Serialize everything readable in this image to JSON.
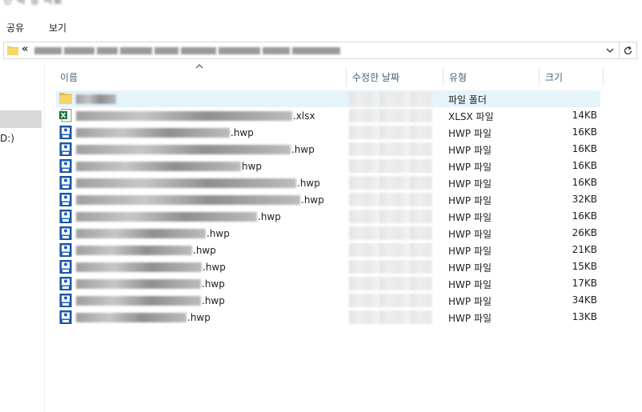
{
  "window": {
    "title": "연 락 망 자료"
  },
  "ribbon": {
    "tabs": [
      "공유",
      "보기"
    ]
  },
  "address": {
    "prefix": "«"
  },
  "nav": {
    "drive_label": "D:)"
  },
  "columns": {
    "name": "이름",
    "date": "수정한 날짜",
    "type": "유형",
    "size": "크기"
  },
  "files": [
    {
      "ext": "",
      "type": "파일 폴더",
      "size": "",
      "icon": "folder-icon",
      "blur": 50,
      "selected": true
    },
    {
      "ext": ".xlsx",
      "type": "XLSX 파일",
      "size": "14KB",
      "icon": "excel-icon",
      "blur": 270
    },
    {
      "ext": ".hwp",
      "type": "HWP 파일",
      "size": "16KB",
      "icon": "hwp-icon",
      "blur": 192
    },
    {
      "ext": ".hwp",
      "type": "HWP 파일",
      "size": "16KB",
      "icon": "hwp-icon",
      "blur": 268
    },
    {
      "ext": "hwp",
      "type": "HWP 파일",
      "size": "16KB",
      "icon": "hwp-icon",
      "blur": 206
    },
    {
      "ext": ".hwp",
      "type": "HWP 파일",
      "size": "16KB",
      "icon": "hwp-icon",
      "blur": 275
    },
    {
      "ext": ".hwp",
      "type": "HWP 파일",
      "size": "32KB",
      "icon": "hwp-icon",
      "blur": 280
    },
    {
      "ext": ".hwp",
      "type": "HWP 파일",
      "size": "16KB",
      "icon": "hwp-icon",
      "blur": 226
    },
    {
      "ext": ".hwp",
      "type": "HWP 파일",
      "size": "26KB",
      "icon": "hwp-icon",
      "blur": 162
    },
    {
      "ext": ".hwp",
      "type": "HWP 파일",
      "size": "21KB",
      "icon": "hwp-icon",
      "blur": 145
    },
    {
      "ext": ".hwp",
      "type": "HWP 파일",
      "size": "15KB",
      "icon": "hwp-icon",
      "blur": 157
    },
    {
      "ext": ".hwp",
      "type": "HWP 파일",
      "size": "17KB",
      "icon": "hwp-icon",
      "blur": 156
    },
    {
      "ext": ".hwp",
      "type": "HWP 파일",
      "size": "34KB",
      "icon": "hwp-icon",
      "blur": 156
    },
    {
      "ext": ".hwp",
      "type": "HWP 파일",
      "size": "13KB",
      "icon": "hwp-icon",
      "blur": 138
    }
  ]
}
